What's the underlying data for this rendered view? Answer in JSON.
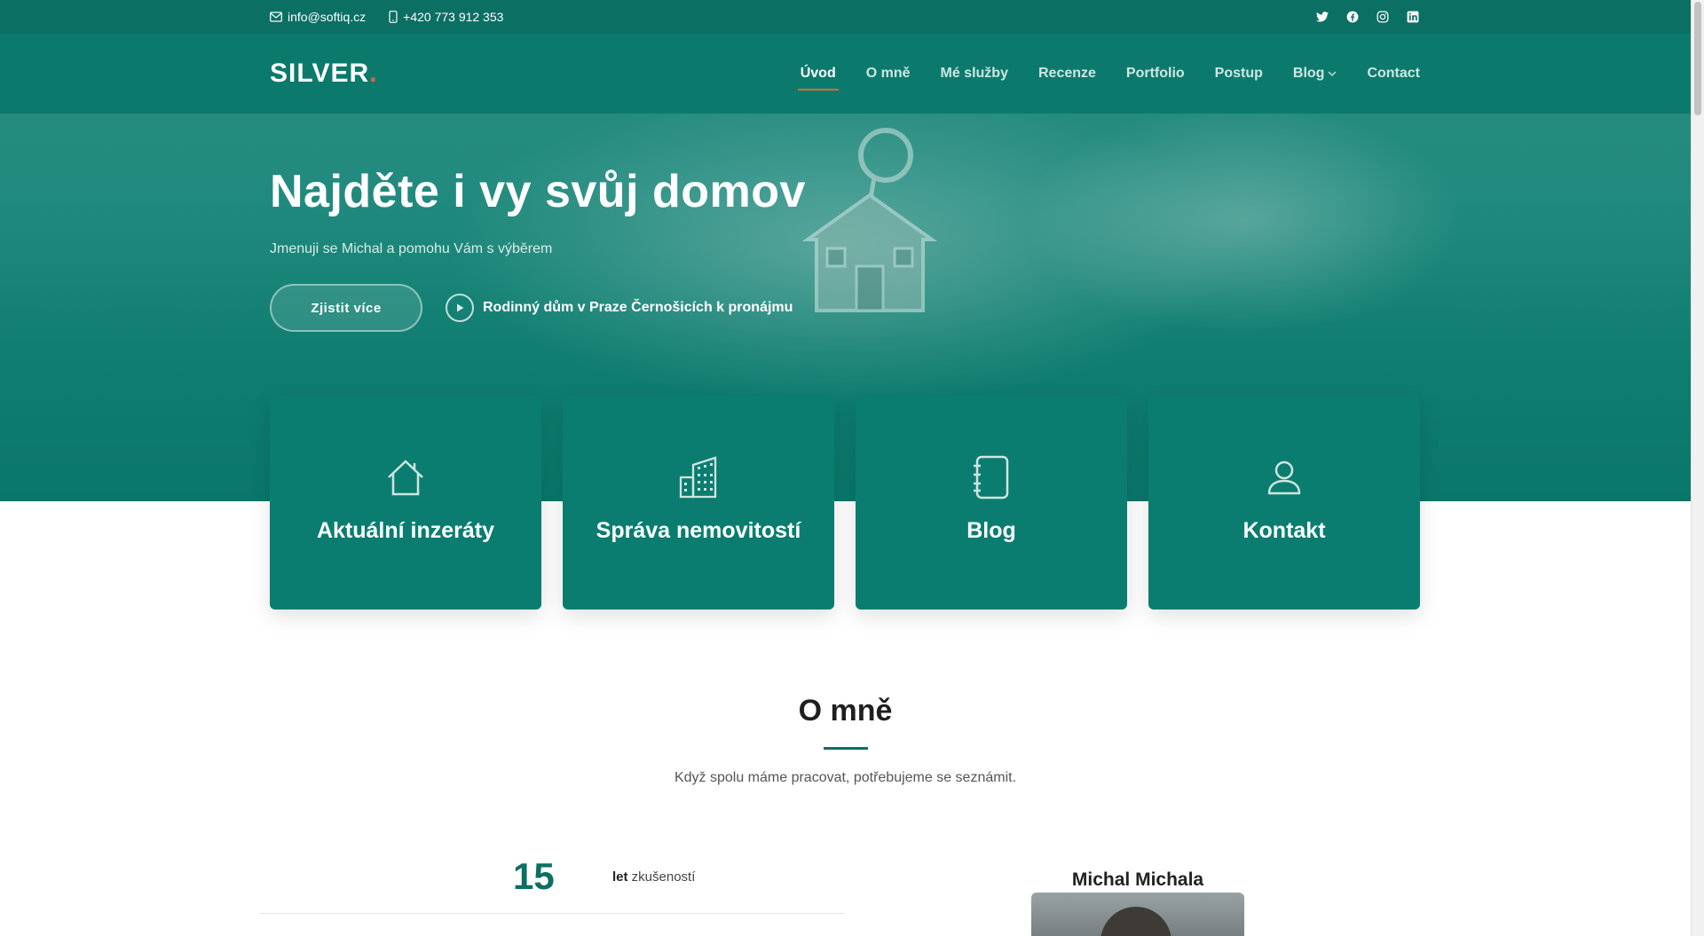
{
  "topbar": {
    "email": "info@softiq.cz",
    "phone": "+420 773 912 353",
    "socials": [
      "twitter-icon",
      "facebook-icon",
      "instagram-icon",
      "linkedin-icon"
    ]
  },
  "header": {
    "logo_text": "SILVER",
    "logo_dot": ".",
    "nav": [
      {
        "label": "Úvod",
        "active": true
      },
      {
        "label": "O mně"
      },
      {
        "label": "Mé služby"
      },
      {
        "label": "Recenze"
      },
      {
        "label": "Portfolio"
      },
      {
        "label": "Postup"
      },
      {
        "label": "Blog",
        "has_dropdown": true
      },
      {
        "label": "Contact"
      }
    ]
  },
  "hero": {
    "title": "Najděte i vy svůj domov",
    "subtitle": "Jmenuji se Michal a pomohu Vám s výběrem",
    "cta_label": "Zjistit více",
    "video_label": "Rodinný dům v Praze Černošicích k pronájmu"
  },
  "cards": [
    {
      "title": "Aktuální inzeráty",
      "icon": "house-icon"
    },
    {
      "title": "Správa nemovitostí",
      "icon": "building-icon"
    },
    {
      "title": "Blog",
      "icon": "notebook-icon"
    },
    {
      "title": "Kontakt",
      "icon": "user-icon"
    }
  ],
  "about": {
    "title": "O mně",
    "subtitle": "Když spolu máme pracovat, potřebujeme se seznámit.",
    "stat_value": "15",
    "stat_label_bold": "let",
    "stat_label_rest": " zkušeností",
    "person_name": "Michal Michala"
  },
  "colors": {
    "primary": "#0b6f64",
    "card": "#0a7d70",
    "accent": "#e8633a"
  }
}
